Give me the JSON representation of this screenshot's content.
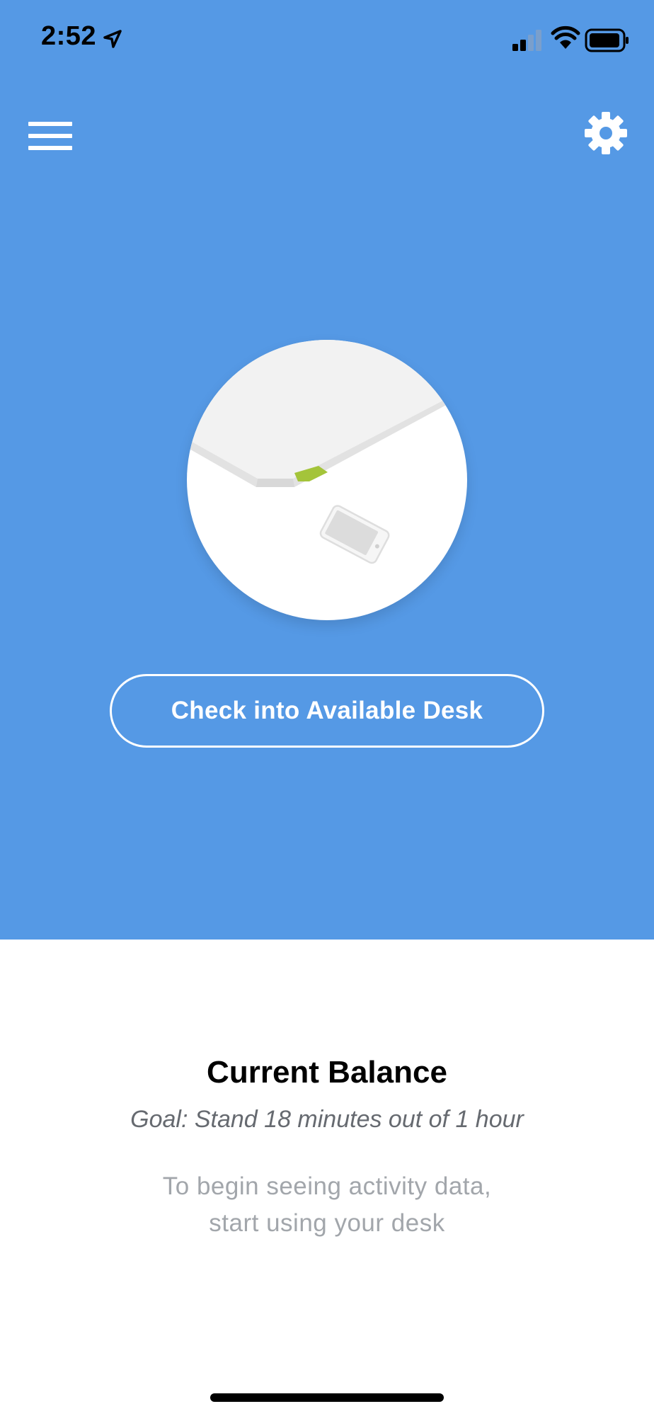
{
  "status_bar": {
    "time": "2:52",
    "location_icon": "location-arrow-icon",
    "signal_icon": "cellular-signal-icon",
    "wifi_icon": "wifi-icon",
    "battery_icon": "battery-icon"
  },
  "nav": {
    "menu_icon": "hamburger-menu-icon",
    "settings_icon": "gear-icon"
  },
  "hero": {
    "illustration": "desk-with-phone-illustration",
    "checkin_label": "Check into Available Desk"
  },
  "balance": {
    "title": "Current Balance",
    "goal": "Goal: Stand 18 minutes out of 1 hour",
    "empty_line1": "To begin seeing activity data,",
    "empty_line2": "start using your desk"
  },
  "colors": {
    "panel_bg": "#5599e5",
    "accent_green": "#a4c43a",
    "button_border": "#ffffff"
  }
}
